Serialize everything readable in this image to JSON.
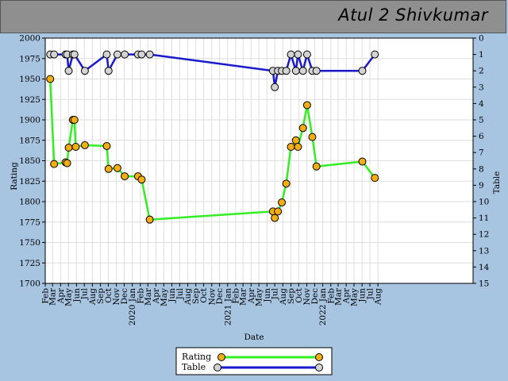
{
  "header": {
    "title": "Atul 2 Shivkumar"
  },
  "chart_data": {
    "type": "line",
    "xlabel": "Date",
    "ylabel": "Rating",
    "y2label": "Table",
    "ylim": [
      1700,
      2000
    ],
    "y2lim": [
      15,
      0
    ],
    "xlim": [
      "2019-02-01",
      "2023-08-01"
    ],
    "grid": true,
    "legend_placement": "bottom",
    "colors": {
      "rating": "#33ee22",
      "table": "#1a1acc",
      "rating_marker": "#f5ad14",
      "table_marker": "#d3d3d3",
      "plot_bg": "#ffffff",
      "grid": "#dedede"
    },
    "x_ticks": [
      "Feb",
      "Mar",
      "Apr",
      "May",
      "Jun",
      "Jul",
      "Aug",
      "Sep",
      "Oct",
      "Nov",
      "Dec",
      "2020 Jan",
      "Feb",
      "Mar",
      "Apr",
      "May",
      "Jun",
      "Jul",
      "Aug",
      "Sep",
      "Oct",
      "Nov",
      "Dec",
      "2021 Jan",
      "Feb",
      "Mar",
      "Apr",
      "May",
      "Jun",
      "Jul",
      "Aug",
      "Sep",
      "Oct",
      "Nov",
      "Dec",
      "2022 Jan",
      "Feb",
      "Mar",
      "Apr",
      "May",
      "Jun",
      "Jul",
      "Aug"
    ],
    "y_ticks": [
      1700,
      1725,
      1750,
      1775,
      1800,
      1825,
      1850,
      1875,
      1900,
      1925,
      1950,
      1975,
      2000
    ],
    "y2_ticks": [
      15,
      14,
      13,
      12,
      11,
      10,
      9,
      8,
      7,
      6,
      5,
      4,
      3,
      2,
      1,
      0
    ],
    "series": [
      {
        "name": "Rating",
        "points": [
          [
            "2019-02-20",
            1950
          ],
          [
            "2019-03-07",
            1846
          ],
          [
            "2019-04-20",
            1848
          ],
          [
            "2019-04-26",
            1847
          ],
          [
            "2019-05-02",
            1866
          ],
          [
            "2019-05-18",
            1900
          ],
          [
            "2019-05-24",
            1900
          ],
          [
            "2019-05-29",
            1867
          ],
          [
            "2019-07-03",
            1869
          ],
          [
            "2019-09-25",
            1868
          ],
          [
            "2019-10-02",
            1840
          ],
          [
            "2019-11-05",
            1841
          ],
          [
            "2019-12-03",
            1831
          ],
          [
            "2020-01-23",
            1831
          ],
          [
            "2020-02-06",
            1827
          ],
          [
            "2020-03-08",
            1778
          ],
          [
            "2021-06-24",
            1788
          ],
          [
            "2021-07-01",
            1780
          ],
          [
            "2021-07-13",
            1788
          ],
          [
            "2021-07-28",
            1799
          ],
          [
            "2021-08-14",
            1822
          ],
          [
            "2021-09-01",
            1867
          ],
          [
            "2021-09-20",
            1875
          ],
          [
            "2021-09-28",
            1867
          ],
          [
            "2021-10-17",
            1890
          ],
          [
            "2021-11-02",
            1918
          ],
          [
            "2021-11-22",
            1879
          ],
          [
            "2021-12-08",
            1843
          ],
          [
            "2022-06-02",
            1849
          ],
          [
            "2022-07-20",
            1829
          ]
        ]
      },
      {
        "name": "Table",
        "points": [
          [
            "2019-02-20",
            1
          ],
          [
            "2019-03-07",
            1
          ],
          [
            "2019-04-20",
            1
          ],
          [
            "2019-04-26",
            1
          ],
          [
            "2019-05-02",
            2
          ],
          [
            "2019-05-18",
            1
          ],
          [
            "2019-05-24",
            1
          ],
          [
            "2019-07-03",
            2
          ],
          [
            "2019-09-25",
            1
          ],
          [
            "2019-10-02",
            2
          ],
          [
            "2019-11-05",
            1
          ],
          [
            "2019-12-03",
            1
          ],
          [
            "2020-01-23",
            1
          ],
          [
            "2020-02-06",
            1
          ],
          [
            "2020-03-08",
            1
          ],
          [
            "2021-06-24",
            2
          ],
          [
            "2021-07-01",
            3
          ],
          [
            "2021-07-13",
            2
          ],
          [
            "2021-07-28",
            2
          ],
          [
            "2021-08-14",
            2
          ],
          [
            "2021-09-01",
            1
          ],
          [
            "2021-09-20",
            2
          ],
          [
            "2021-09-28",
            1
          ],
          [
            "2021-10-17",
            2
          ],
          [
            "2021-11-02",
            1
          ],
          [
            "2021-11-22",
            2
          ],
          [
            "2021-12-08",
            2
          ],
          [
            "2022-06-02",
            2
          ],
          [
            "2022-07-20",
            1
          ]
        ]
      }
    ]
  }
}
